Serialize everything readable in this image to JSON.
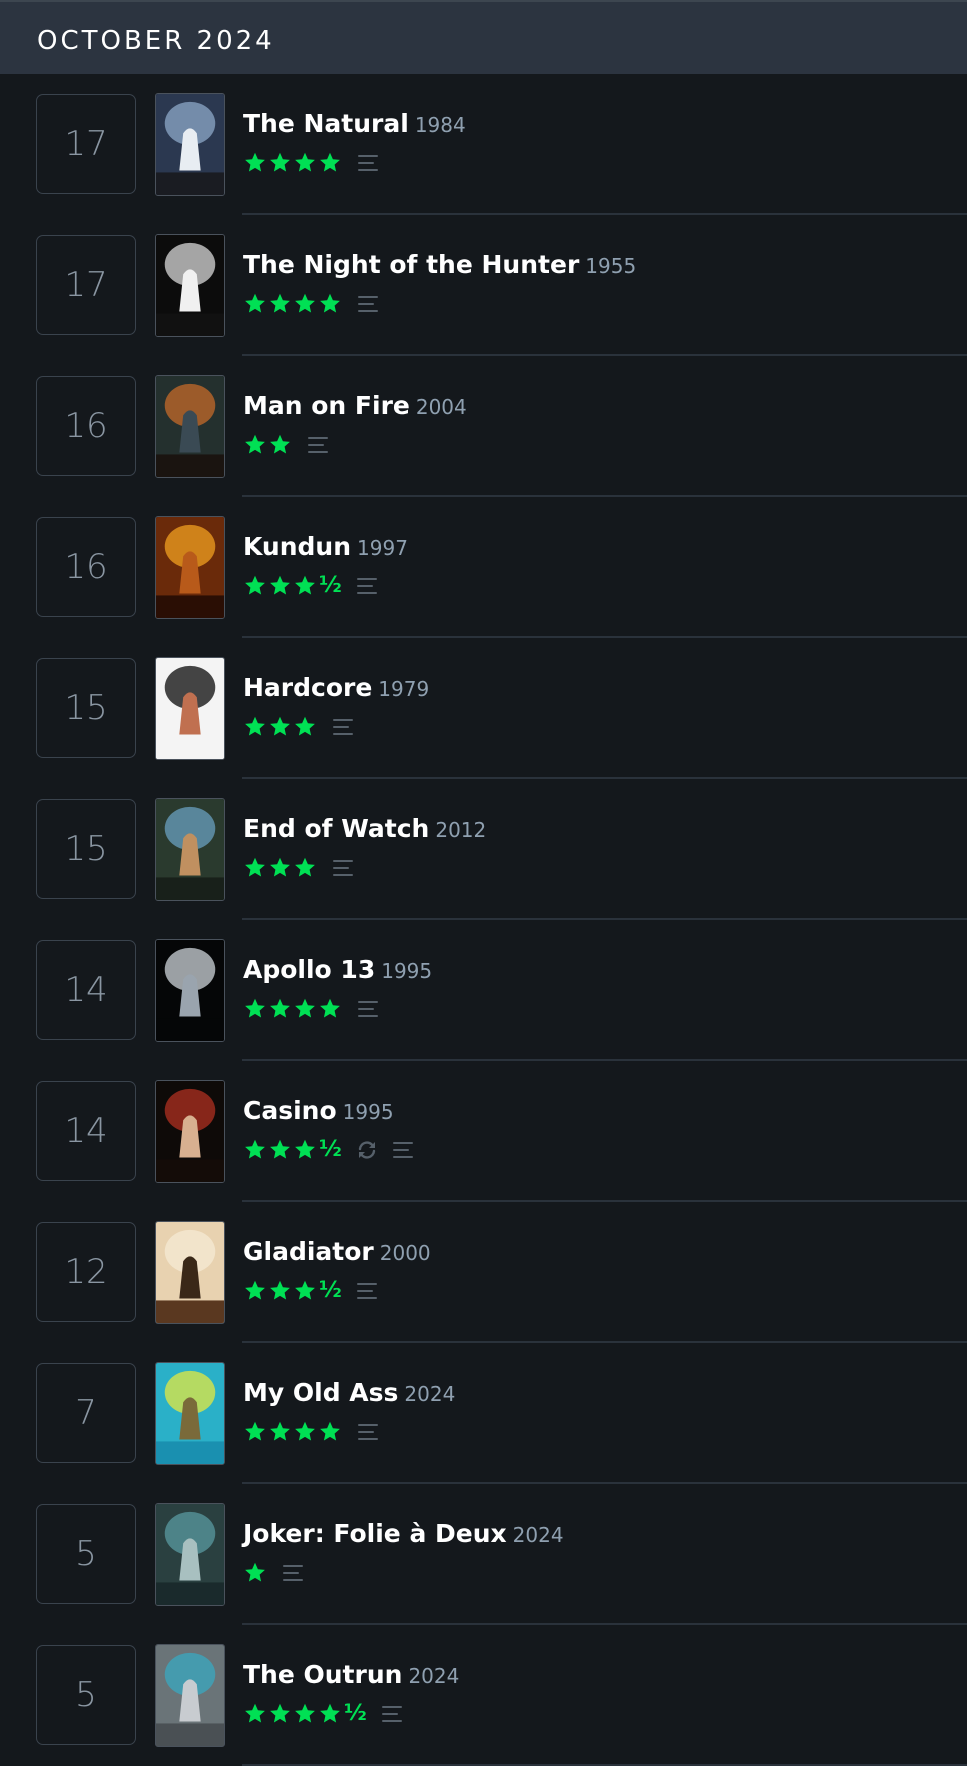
{
  "header": {
    "month": "OCTOBER 2024"
  },
  "colors": {
    "background": "#14181c",
    "header_bg": "#2c3440",
    "star": "#00e054",
    "muted_icon": "#56606a",
    "day_text": "#8a96a2"
  },
  "entries": [
    {
      "day": "17",
      "title": "The Natural",
      "year": "1984",
      "stars": 4,
      "half": false,
      "half_label": "",
      "rewatch": false,
      "poster": {
        "bg": "#2b3850",
        "hi": "#8ea8c8",
        "fig": "#e8edf2",
        "foot": "#1a1c22"
      }
    },
    {
      "day": "17",
      "title": "The Night of the Hunter",
      "year": "1955",
      "stars": 4,
      "half": false,
      "half_label": "",
      "rewatch": false,
      "poster": {
        "bg": "#0c0c0c",
        "hi": "#d8d8d8",
        "fig": "#f0f0f0",
        "foot": "#111111"
      }
    },
    {
      "day": "16",
      "title": "Man on Fire",
      "year": "2004",
      "stars": 2,
      "half": false,
      "half_label": "",
      "rewatch": false,
      "poster": {
        "bg": "#24302e",
        "hi": "#c46a2a",
        "fig": "#3a4a54",
        "foot": "#1a1410"
      }
    },
    {
      "day": "16",
      "title": "Kundun",
      "year": "1997",
      "stars": 3,
      "half": true,
      "half_label": "½",
      "rewatch": false,
      "poster": {
        "bg": "#6a2a0a",
        "hi": "#f2a020",
        "fig": "#b85a1a",
        "foot": "#2a0e04"
      }
    },
    {
      "day": "15",
      "title": "Hardcore",
      "year": "1979",
      "stars": 3,
      "half": false,
      "half_label": "",
      "rewatch": false,
      "poster": {
        "bg": "#f4f4f4",
        "hi": "#0a0a0a",
        "fig": "#c07050",
        "foot": "#f4f4f4"
      }
    },
    {
      "day": "15",
      "title": "End of Watch",
      "year": "2012",
      "stars": 3,
      "half": false,
      "half_label": "",
      "rewatch": false,
      "poster": {
        "bg": "#2a3a2e",
        "hi": "#6aa0c0",
        "fig": "#c09060",
        "foot": "#18201a"
      }
    },
    {
      "day": "14",
      "title": "Apollo 13",
      "year": "1995",
      "stars": 4,
      "half": false,
      "half_label": "",
      "rewatch": false,
      "poster": {
        "bg": "#050607",
        "hi": "#cdd4da",
        "fig": "#9aa4ae",
        "foot": "#050607"
      }
    },
    {
      "day": "14",
      "title": "Casino",
      "year": "1995",
      "stars": 3,
      "half": true,
      "half_label": "½",
      "rewatch": true,
      "poster": {
        "bg": "#0e0a08",
        "hi": "#b03020",
        "fig": "#d8b090",
        "foot": "#140c08"
      }
    },
    {
      "day": "12",
      "title": "Gladiator",
      "year": "2000",
      "stars": 3,
      "half": true,
      "half_label": "½",
      "rewatch": false,
      "poster": {
        "bg": "#e8d2b0",
        "hi": "#f6ead4",
        "fig": "#3a2818",
        "foot": "#5a3820"
      }
    },
    {
      "day": "7",
      "title": "My Old Ass",
      "year": "2024",
      "stars": 4,
      "half": false,
      "half_label": "",
      "rewatch": false,
      "poster": {
        "bg": "#2ab0c8",
        "hi": "#e4e840",
        "fig": "#7a6a3a",
        "foot": "#1a90b0"
      }
    },
    {
      "day": "5",
      "title": "Joker: Folie à Deux",
      "year": "2024",
      "stars": 1,
      "half": false,
      "half_label": "",
      "rewatch": false,
      "poster": {
        "bg": "#2a4040",
        "hi": "#5a9aa0",
        "fig": "#a8c0c0",
        "foot": "#1a2a2c"
      }
    },
    {
      "day": "5",
      "title": "The Outrun",
      "year": "2024",
      "stars": 4,
      "half": true,
      "half_label": "½",
      "rewatch": false,
      "poster": {
        "bg": "#6a7478",
        "hi": "#3aa8c0",
        "fig": "#c8ccd0",
        "foot": "#4a5054"
      }
    }
  ]
}
